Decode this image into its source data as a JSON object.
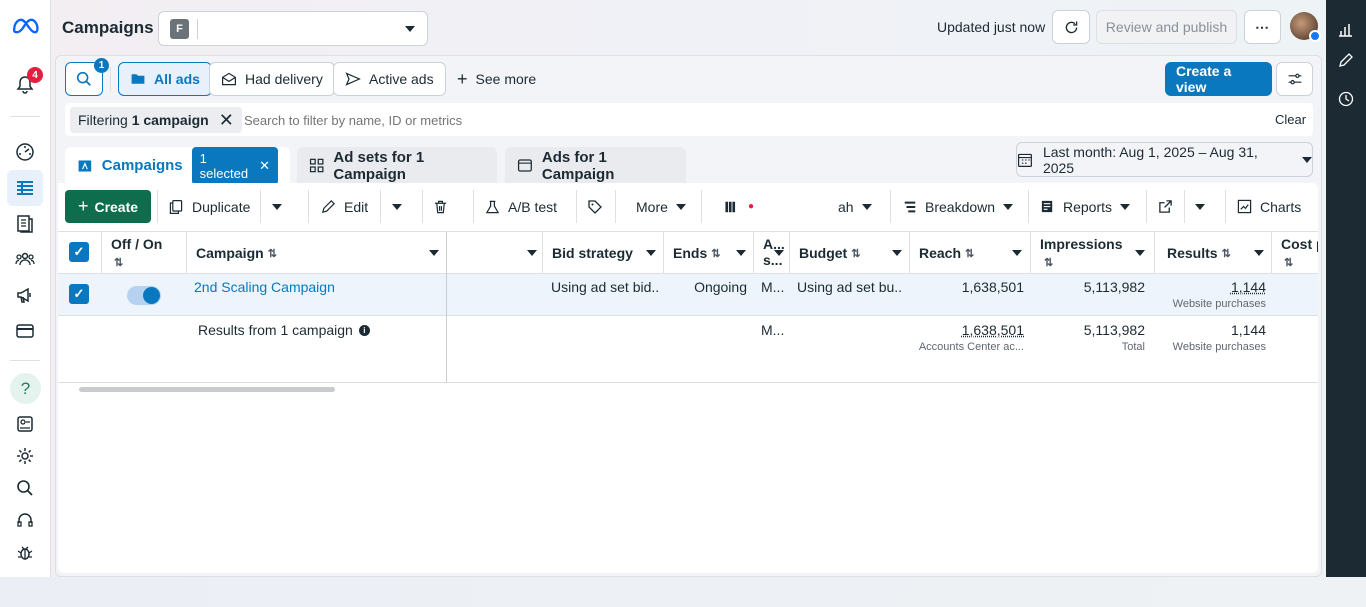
{
  "header": {
    "title": "Campaigns",
    "account_initial": "F",
    "updated_text": "Updated just now",
    "review_publish_label": "Review and publish"
  },
  "rail": {
    "notification_count": "4",
    "help_label": "?"
  },
  "filters": {
    "search_badge": "1",
    "chips": [
      "All ads",
      "Had delivery",
      "Active ads",
      "See more"
    ],
    "create_view_label": "Create a view",
    "filter_tag_prefix": "Filtering",
    "filter_tag_value": "1 campaign",
    "search_placeholder": "Search to filter by name, ID or metrics",
    "clear_label": "Clear"
  },
  "tabs": {
    "campaigns_label": "Campaigns",
    "selected_label": "1 selected",
    "adsets_label": "Ad sets for 1 Campaign",
    "ads_label": "Ads for 1 Campaign",
    "date_range": "Last month: Aug 1, 2025 – Aug 31, 2025"
  },
  "toolbar": {
    "create": "Create",
    "duplicate": "Duplicate",
    "edit": "Edit",
    "ab_test": "A/B test",
    "more": "More",
    "columns_partial": "ah",
    "breakdown": "Breakdown",
    "reports": "Reports",
    "charts": "Charts"
  },
  "table": {
    "headers": {
      "off_on": "Off / On",
      "campaign": "Campaign",
      "bid_strategy": "Bid strategy",
      "ends": "Ends",
      "attribution_a": "A...",
      "attribution_b": "s...",
      "budget": "Budget",
      "reach": "Reach",
      "impressions": "Impressions",
      "results": "Results",
      "cost": "Cost p"
    },
    "row": {
      "campaign_name": "2nd Scaling Campaign",
      "toggle_on": true,
      "bid_strategy": "Using ad set bid...",
      "ends": "Ongoing",
      "attribution": "M...",
      "budget": "Using ad set bu...",
      "reach": "1,638,501",
      "impressions": "5,113,982",
      "results": "1,144",
      "results_sub": "Website purchases"
    },
    "summary": {
      "label": "Results from 1 campaign",
      "attribution": "M...",
      "reach": "1,638,501",
      "reach_sub": "Accounts Center ac...",
      "impressions": "5,113,982",
      "impressions_sub": "Total",
      "results": "1,144",
      "results_sub": "Website purchases"
    }
  },
  "colors": {
    "primary_blue": "#0a78be",
    "create_green": "#0d6d4c",
    "rail_dark": "#1c2b33",
    "badge_red": "#e41e3f"
  }
}
